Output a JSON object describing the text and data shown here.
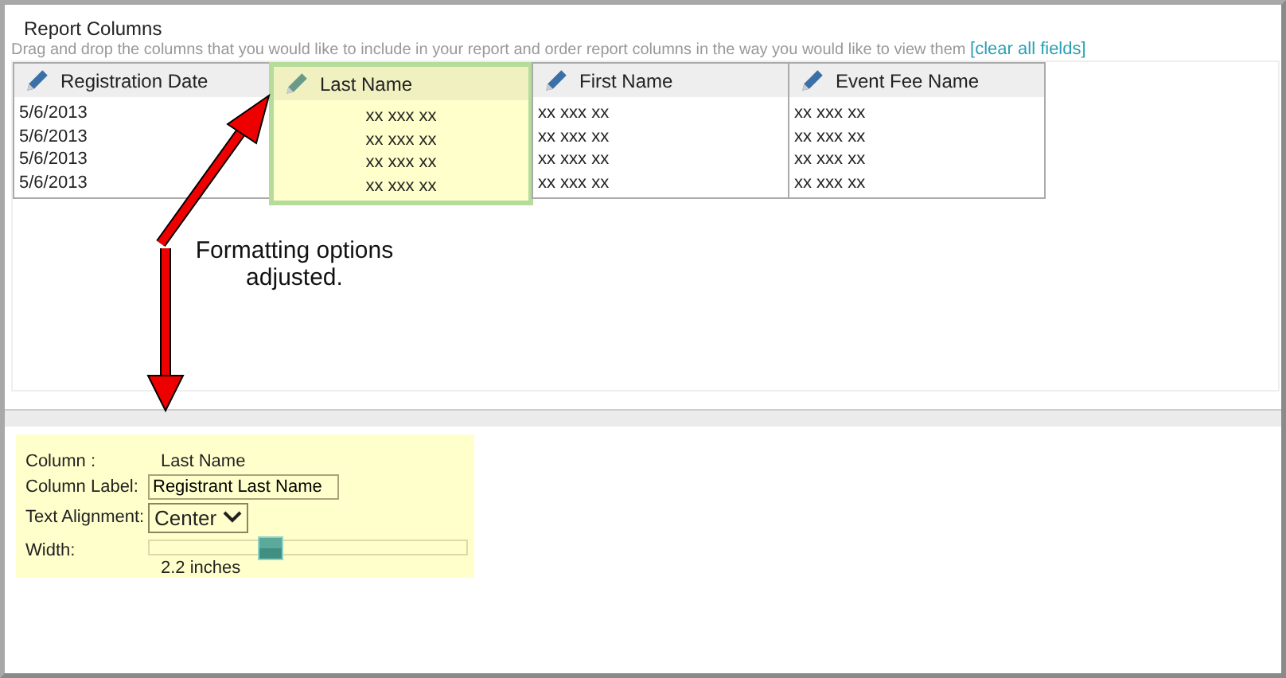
{
  "section": {
    "title": "Report Columns",
    "description": "Drag and drop the columns that you would like to include in your report and order report columns in the way you would like to view them",
    "link": "[clear all fields]"
  },
  "columns": [
    {
      "header": "Registration Date",
      "selected": false,
      "kind": "plain",
      "cells": [
        "5/6/2013",
        "5/6/2013",
        "5/6/2013",
        "5/6/2013"
      ]
    },
    {
      "header": "Last Name",
      "selected": true,
      "kind": "centered",
      "cells": [
        "xx xxx xx",
        "xx xxx xx",
        "xx xxx xx",
        "xx xxx xx"
      ]
    },
    {
      "header": "First Name",
      "selected": false,
      "kind": "plain",
      "cells": [
        "xx xxx xx",
        "xx xxx xx",
        "xx xxx xx",
        "xx xxx xx"
      ]
    },
    {
      "header": "Event Fee Name",
      "selected": false,
      "kind": "plain",
      "cells": [
        "xx xxx xx",
        "xx xxx xx",
        "xx xxx xx",
        "xx xxx xx"
      ]
    }
  ],
  "annotation": "Formatting options adjusted.",
  "format_panel": {
    "column_label": "Column :",
    "column_value": "Last Name",
    "label_label": "Column Label:",
    "label_value": "Registrant Last Name",
    "alignment_label": "Text Alignment:",
    "alignment_value": "Center",
    "width_label": "Width:",
    "width": {
      "level": 0.38
    },
    "width_reading": "2.2 inches"
  }
}
